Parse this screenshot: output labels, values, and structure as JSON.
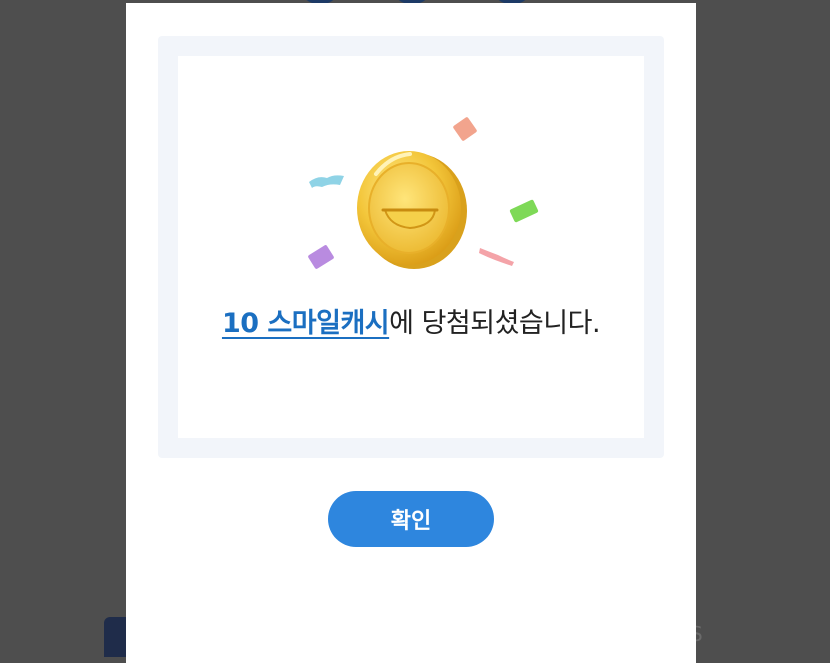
{
  "background": {
    "overlay_color": "#4e4e4e",
    "partial_glyph": "S"
  },
  "dialog": {
    "prize_text": "10 스마일캐시",
    "message_suffix": "에 당첨되셨습니다.",
    "confirm_label": "확인",
    "illustration_icon": "gold-coin-with-confetti-icon",
    "colors": {
      "accent": "#2e86de",
      "prize_text": "#1b6fc1",
      "frame": "#f2f5fa",
      "coin": "#f3c63a"
    }
  }
}
